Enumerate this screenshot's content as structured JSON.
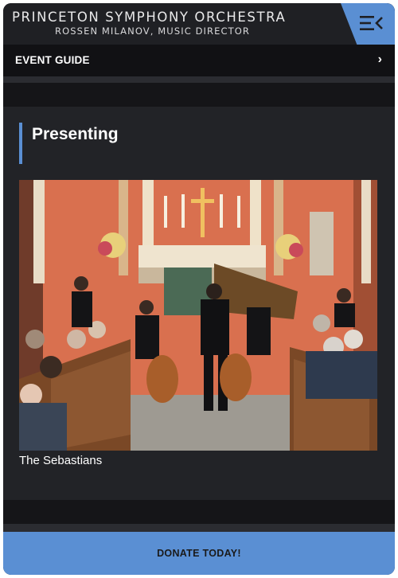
{
  "header": {
    "title": "PRINCETON SYMPHONY ORCHESTRA",
    "subtitle": "ROSSEN MILANOV, MUSIC DIRECTOR",
    "menu_icon": "menu-collapse-icon"
  },
  "event_guide": {
    "label": "EVENT GUIDE",
    "chevron": "›"
  },
  "presenting": {
    "heading": "Presenting",
    "image_icon": "concert-photo",
    "caption": "The Sebastians"
  },
  "footer": {
    "donate_label": "DONATE TODAY!"
  },
  "colors": {
    "accent": "#5a8fd3",
    "background": "#1f2024"
  }
}
